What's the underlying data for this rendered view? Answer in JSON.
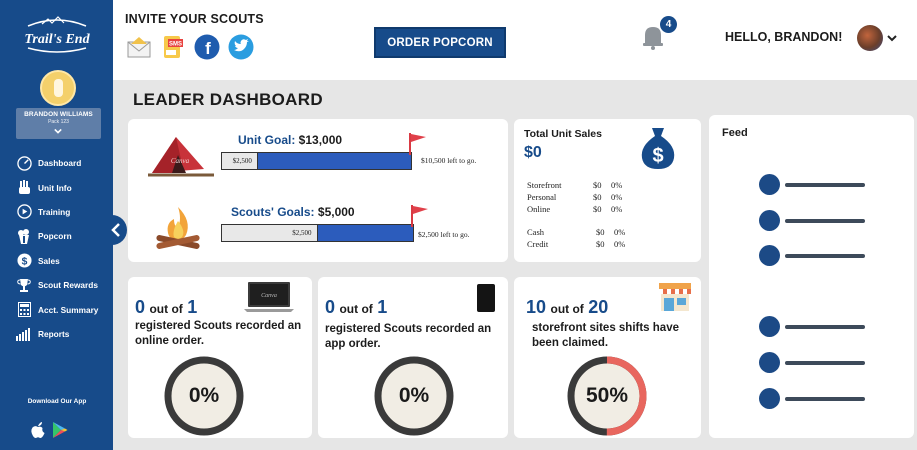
{
  "brand": {
    "logo_text": "Trail's End"
  },
  "user": {
    "name": "BRANDON WILLIAMS",
    "pack": "Pack 123"
  },
  "nav": [
    {
      "label": "Dashboard",
      "icon": "dashboard-icon"
    },
    {
      "label": "Unit Info",
      "icon": "hand-icon"
    },
    {
      "label": "Training",
      "icon": "play-icon"
    },
    {
      "label": "Popcorn",
      "icon": "popcorn-icon"
    },
    {
      "label": "Sales",
      "icon": "dollar-icon"
    },
    {
      "label": "Scout Rewards",
      "icon": "trophy-icon"
    },
    {
      "label": "Acct. Summary",
      "icon": "calculator-icon"
    },
    {
      "label": "Reports",
      "icon": "bar-chart-icon"
    }
  ],
  "download": {
    "label": "Download Our App"
  },
  "header": {
    "invite_title": "INVITE YOUR SCOUTS",
    "order_button": "ORDER POPCORN",
    "notifications": "4",
    "greeting": "HELLO, BRANDON!"
  },
  "dashboard_title": "LEADER DASHBOARD",
  "goals": {
    "unit": {
      "label": "Unit Goal:",
      "value": "$13,000",
      "progress_text": "$2,500",
      "left_text": "$10,500 left to go.",
      "fraction": 0.19
    },
    "scouts": {
      "label": "Scouts' Goals:",
      "value": "$5,000",
      "progress_text": "$2,500",
      "left_text": "$2,500 left to go.",
      "fraction": 0.5
    }
  },
  "sales": {
    "title": "Total Unit Sales",
    "total": "$0",
    "rows1": [
      {
        "name": "Storefront",
        "value": "$0",
        "pct": "0%"
      },
      {
        "name": "Personal",
        "value": "$0",
        "pct": "0%"
      },
      {
        "name": "Online",
        "value": "$0",
        "pct": "0%"
      }
    ],
    "rows2": [
      {
        "name": "Cash",
        "value": "$0",
        "pct": "0%"
      },
      {
        "name": "Credit",
        "value": "$0",
        "pct": "0%"
      }
    ]
  },
  "feed": {
    "title": "Feed"
  },
  "online": {
    "count": "0",
    "out_of": "out of",
    "total": "1",
    "text": "registered Scouts recorded an online order.",
    "percent": "0%",
    "fraction": 0
  },
  "app": {
    "count": "0",
    "out_of": "out of",
    "total": "1",
    "text": "registered Scouts recorded an app order.",
    "percent": "0%",
    "fraction": 0
  },
  "store": {
    "count": "10",
    "out_of": "out of",
    "total": "20",
    "text": "storefront sites shifts have been claimed.",
    "percent": "50%",
    "fraction": 0.5
  },
  "colors": {
    "primary": "#174b8a",
    "bar_fill": "#2c5cbc",
    "ring_track": "#3a3a3a",
    "ring_progress": "#e8665e",
    "flag": "#e0404a"
  }
}
